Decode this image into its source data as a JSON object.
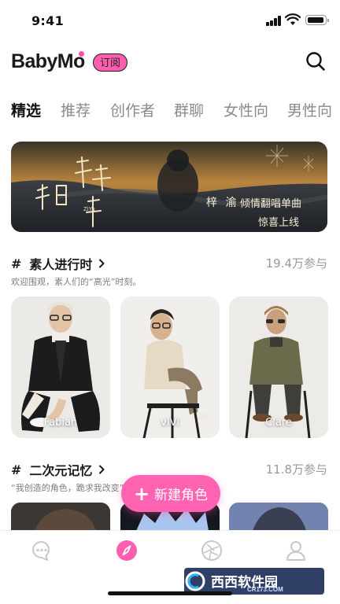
{
  "status": {
    "time": "9:41"
  },
  "header": {
    "logo": "BabyMo",
    "badge": "订阅"
  },
  "tabs": [
    {
      "label": "精选",
      "active": true
    },
    {
      "label": "推荐",
      "active": false
    },
    {
      "label": "创作者",
      "active": false
    },
    {
      "label": "群聊",
      "active": false
    },
    {
      "label": "女性向",
      "active": false
    },
    {
      "label": "男性向",
      "active": false
    }
  ],
  "banner": {
    "artist": "梓 渝",
    "line1": "倾情翻唱单曲",
    "line2": "惊喜上线",
    "art_small": "ZiYu"
  },
  "section1": {
    "hash": "#",
    "title": "素人进行时",
    "count": "19.4万参与",
    "subtitle": "欢迎围观，素人们的“高光”时刻。",
    "cards": [
      {
        "name": "Fabian"
      },
      {
        "name": "vIVi"
      },
      {
        "name": "Clare"
      }
    ]
  },
  "section2": {
    "hash": "#",
    "title": "二次元记忆",
    "count": "11.8万参与",
    "subtitle": "“我创造的角色，跪求我改变”"
  },
  "fab": {
    "plus": "+",
    "label": "新建角色"
  },
  "nav": [
    "chat-bubble-icon",
    "discover-compass-icon",
    "aperture-icon",
    "profile-icon"
  ],
  "watermark": {
    "brand": "西西软件园",
    "url": "CR173.COM"
  },
  "colors": {
    "accent": "#ff5fae",
    "text": "#1b1b1b",
    "muted": "#8a8a8a"
  }
}
